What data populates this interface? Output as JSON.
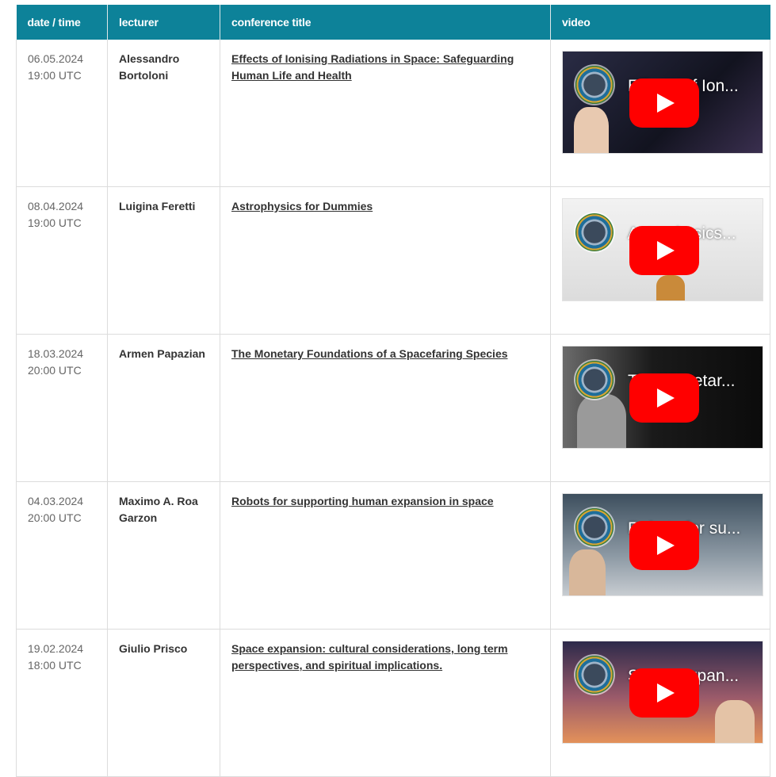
{
  "headers": {
    "date": "date / time",
    "lecturer": "lecturer",
    "title": "conference title",
    "video": "video"
  },
  "rows": [
    {
      "date": "06.05.2024",
      "time": "19:00 UTC",
      "lecturer": "Alessandro Bortoloni",
      "title": "Effects of Ionising Radiations in Space: Safeguarding Human Life and Health",
      "video_title": "Effects of Ion...",
      "thumb_color": "#1b1d2e"
    },
    {
      "date": "08.04.2024",
      "time": "19:00 UTC",
      "lecturer": "Luigina Feretti",
      "title": "Astrophysics for Dummies",
      "video_title": "Astrophysics...",
      "thumb_color": "#d9d9d9"
    },
    {
      "date": "18.03.2024",
      "time": "20:00 UTC",
      "lecturer": "Armen Papazian",
      "title": "The Monetary Foundations of a Spacefaring Species",
      "video_title": "The Monetar...",
      "thumb_color": "#111111"
    },
    {
      "date": "04.03.2024",
      "time": "20:00 UTC",
      "lecturer": "Maximo A. Roa Garzon",
      "title": "Robots for supporting human expansion in space",
      "video_title": "Robots for su...",
      "thumb_color": "#6a7a86"
    },
    {
      "date": "19.02.2024",
      "time": "18:00 UTC",
      "lecturer": "Giulio Prisco",
      "title": "Space expansion: cultural considerations, long term perspectives, and spiritual implications.",
      "video_title": "Space expan...",
      "thumb_color": "#5a4a6a"
    }
  ],
  "colors": {
    "header_bg": "#0d8299",
    "play_button": "#ff0000"
  }
}
